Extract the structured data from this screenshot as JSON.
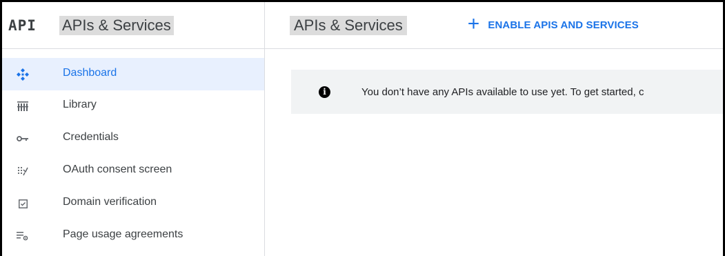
{
  "sidebar": {
    "logo": "API",
    "title": "APIs & Services",
    "items": [
      {
        "label": "Dashboard",
        "icon": "dashboard-icon",
        "active": true
      },
      {
        "label": "Library",
        "icon": "library-icon",
        "active": false
      },
      {
        "label": "Credentials",
        "icon": "key-icon",
        "active": false
      },
      {
        "label": "OAuth consent screen",
        "icon": "oauth-icon",
        "active": false
      },
      {
        "label": "Domain verification",
        "icon": "checkbox-icon",
        "active": false
      },
      {
        "label": "Page usage agreements",
        "icon": "settings-list-icon",
        "active": false
      }
    ]
  },
  "header": {
    "title": "APIs & Services",
    "enable_label": "ENABLE APIS AND SERVICES",
    "enable_icon": "plus-icon"
  },
  "banner": {
    "icon": "info-icon",
    "text": "You don’t have any APIs available to use yet. To get started, c"
  },
  "colors": {
    "accent": "#1a73e8",
    "active_bg": "#e8f0fe",
    "banner_bg": "#f1f3f4",
    "title_highlight": "#dcdcdc"
  }
}
